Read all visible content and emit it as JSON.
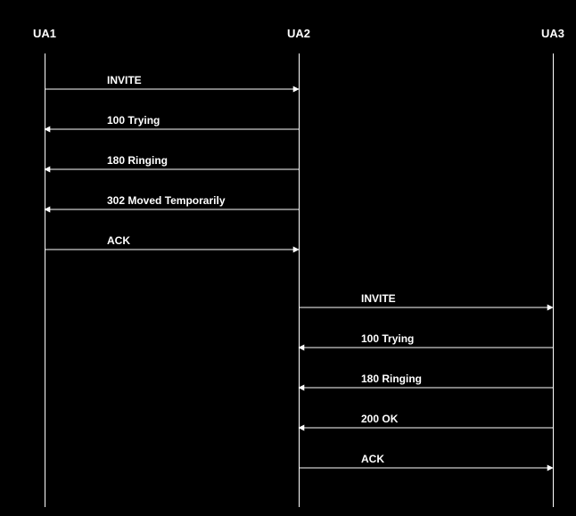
{
  "actors": {
    "ua1": "UA1",
    "ua2": "UA2",
    "ua3": "UA3"
  },
  "messages": {
    "m1": "INVITE",
    "m2": "100 Trying",
    "m3": "180 Ringing",
    "m4": "302 Moved Temporarily",
    "m5": "ACK",
    "m6": "INVITE",
    "m7": "100 Trying",
    "m8": "180 Ringing",
    "m9": "200 OK",
    "m10": "ACK"
  }
}
